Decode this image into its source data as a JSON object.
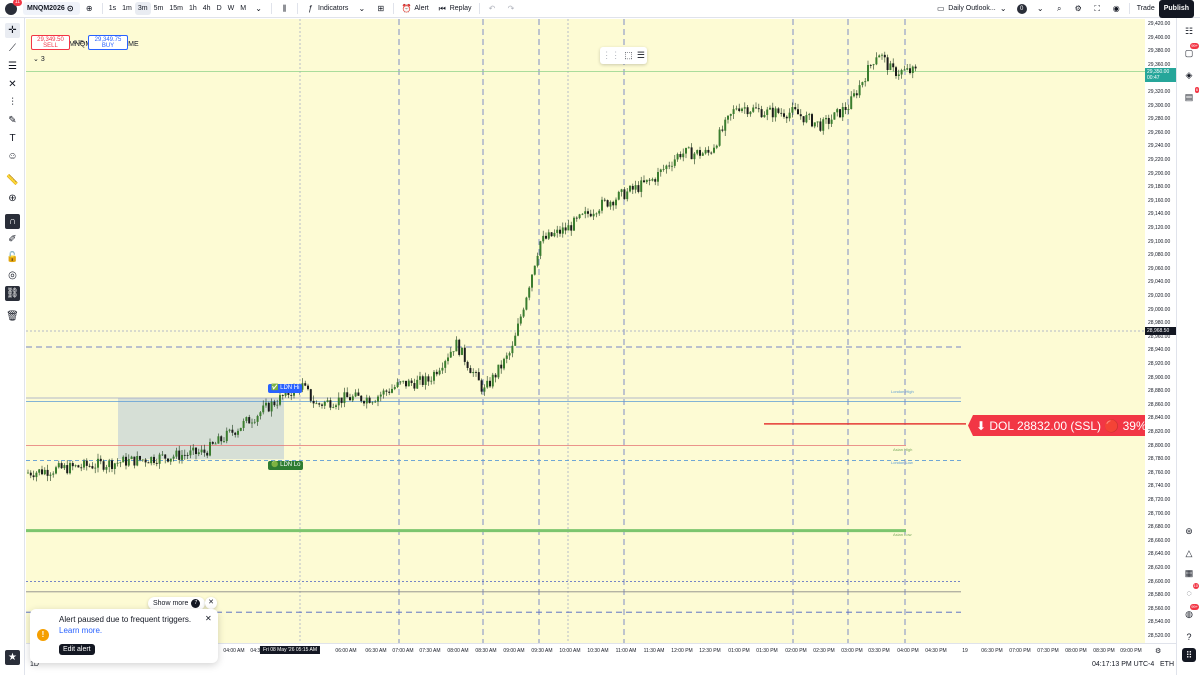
{
  "topbar": {
    "avatar_badge": "11",
    "symbol": "MNQM2026",
    "intervals": [
      "1s",
      "1m",
      "3m",
      "5m",
      "15m",
      "1h",
      "4h",
      "D",
      "W",
      "M"
    ],
    "active_interval": "3m",
    "indicators_label": "Indicators",
    "alert_label": "Alert",
    "replay_label": "Replay",
    "layout_name": "Daily Outlook...",
    "layout_badge": "0",
    "trade_label": "Trade",
    "publish_label": "Publish"
  },
  "legend": {
    "title": "MNQM2026 · 3 · CME",
    "sell_price": "29,349.50",
    "sell_label": "SELL",
    "spread": "0.25",
    "buy_price": "29,349.75",
    "buy_label": "BUY",
    "collapse_count": "3"
  },
  "price_axis": {
    "labels": [
      "29,420.00",
      "29,400.00",
      "29,380.00",
      "29,360.00",
      "29,340.00",
      "29,320.00",
      "29,300.00",
      "29,280.00",
      "29,260.00",
      "29,240.00",
      "29,220.00",
      "29,200.00",
      "29,180.00",
      "29,160.00",
      "29,140.00",
      "29,120.00",
      "29,100.00",
      "29,080.00",
      "29,060.00",
      "29,040.00",
      "29,020.00",
      "29,000.00",
      "28,980.00",
      "28,960.00",
      "28,940.00",
      "28,920.00",
      "28,900.00",
      "28,880.00",
      "28,860.00",
      "28,840.00",
      "28,820.00",
      "28,800.00",
      "28,780.00",
      "28,760.00",
      "28,740.00",
      "28,720.00",
      "28,700.00",
      "28,680.00",
      "28,660.00",
      "28,640.00",
      "28,620.00",
      "28,600.00",
      "28,580.00",
      "28,560.00",
      "28,540.00",
      "28,520.00"
    ],
    "last_price": "29,350.00",
    "last_countdown": "00:47",
    "crosshair_price": "28,968.50"
  },
  "time_axis": {
    "labels": [
      "04:00 AM",
      "04:30 AM",
      "05:15 AM",
      "06:00 AM",
      "06:30 AM",
      "07:00 AM",
      "07:30 AM",
      "08:00 AM",
      "08:30 AM",
      "09:00 AM",
      "09:30 AM",
      "10:00 AM",
      "10:30 AM",
      "11:00 AM",
      "11:30 AM",
      "12:00 PM",
      "12:30 PM",
      "01:00 PM",
      "01:30 PM",
      "02:00 PM",
      "02:30 PM",
      "03:00 PM",
      "03:30 PM",
      "04:00 PM",
      "04:30 PM",
      "19",
      "06:30 PM",
      "07:00 PM",
      "07:30 PM",
      "08:00 PM",
      "08:30 PM",
      "09:00 PM"
    ],
    "cursor_label": "Fri 08 May '26  05:15 AM"
  },
  "bottombar": {
    "clock": "04:17:13 PM UTC-4",
    "session": "ETH"
  },
  "annotations": {
    "ldn_high": "LDN Hi",
    "ldn_low": "LDN Lo",
    "london_high": "London High",
    "london_low": "London Low",
    "asian_high": "Asian High",
    "asian_low": "Asian Low",
    "dol_text": "⬇ DOL 28832.00 (SSL) 🔴 39%"
  },
  "toast": {
    "title": "Alert paused due to frequent triggers.",
    "link": "Learn more.",
    "button": "Edit alert",
    "show_more": "Show more",
    "show_more_count": "7"
  },
  "right_badges": {
    "ideas": "99+",
    "alerts": "6",
    "notifications": "10",
    "chat": "99+"
  },
  "colors": {
    "chart_bg": "#fdfbd4",
    "up": "#26a69a",
    "candle": "#1b5e20",
    "down": "#f23645",
    "accent": "#2962ff"
  },
  "chart_data": {
    "type": "candlestick",
    "x_range": [
      "04:00 AM",
      "09:00 PM"
    ],
    "ylim": [
      28520,
      29420
    ],
    "key_levels": [
      {
        "name": "London High",
        "value": 28870
      },
      {
        "name": "London Low",
        "value": 28780
      },
      {
        "name": "Asian High",
        "value": 28800
      },
      {
        "name": "Asian Low",
        "value": 28675
      },
      {
        "name": "DOL",
        "value": 28832
      }
    ],
    "close_path": [
      {
        "x": "03:30 AM",
        "y": 28760
      },
      {
        "x": "04:00 AM",
        "y": 28790
      },
      {
        "x": "04:30 AM",
        "y": 28820
      },
      {
        "x": "05:00 AM",
        "y": 28860
      },
      {
        "x": "05:15 AM",
        "y": 28890
      },
      {
        "x": "06:00 AM",
        "y": 28860
      },
      {
        "x": "06:30 AM",
        "y": 28870
      },
      {
        "x": "07:00 AM",
        "y": 28870
      },
      {
        "x": "07:30 AM",
        "y": 28890
      },
      {
        "x": "08:00 AM",
        "y": 28895
      },
      {
        "x": "08:30 AM",
        "y": 28950
      },
      {
        "x": "09:00 AM",
        "y": 28880
      },
      {
        "x": "09:30 AM",
        "y": 28940
      },
      {
        "x": "10:00 AM",
        "y": 29100
      },
      {
        "x": "10:30 AM",
        "y": 29120
      },
      {
        "x": "11:00 AM",
        "y": 29150
      },
      {
        "x": "11:30 AM",
        "y": 29170
      },
      {
        "x": "12:00 PM",
        "y": 29190
      },
      {
        "x": "12:30 PM",
        "y": 29230
      },
      {
        "x": "01:00 PM",
        "y": 29230
      },
      {
        "x": "01:30 PM",
        "y": 29300
      },
      {
        "x": "02:00 PM",
        "y": 29290
      },
      {
        "x": "02:30 PM",
        "y": 29290
      },
      {
        "x": "03:00 PM",
        "y": 29270
      },
      {
        "x": "03:30 PM",
        "y": 29300
      },
      {
        "x": "04:00 PM",
        "y": 29380
      },
      {
        "x": "04:15 PM",
        "y": 29350
      }
    ]
  }
}
